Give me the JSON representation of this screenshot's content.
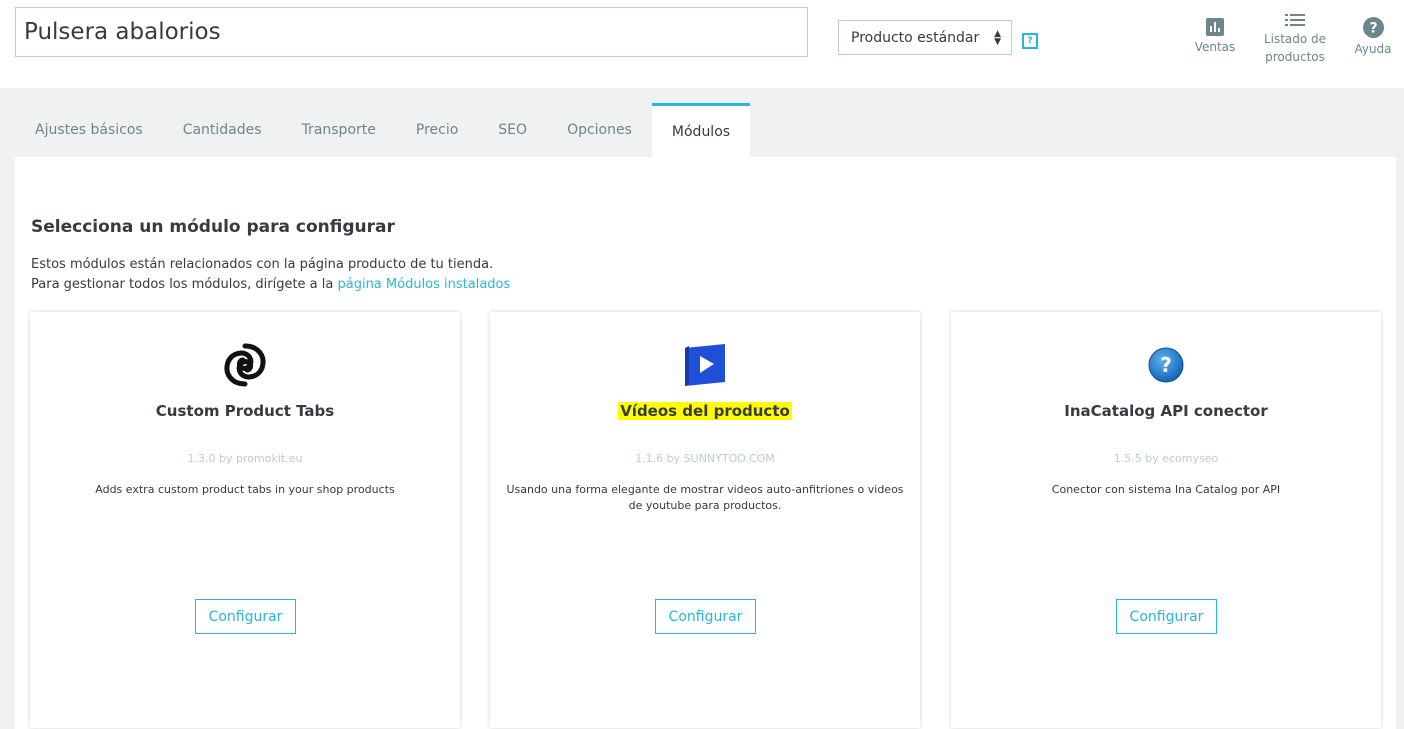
{
  "product": {
    "name_value": "Pulsera abalorios",
    "type_selected": "Producto estándar",
    "help_glyph": "?"
  },
  "header_actions": [
    {
      "label": "Ventas",
      "icon": "chart-icon"
    },
    {
      "label": "Listado de productos",
      "icon": "list-icon"
    },
    {
      "label": "Ayuda",
      "icon": "help-icon"
    }
  ],
  "tabs": [
    {
      "label": "Ajustes básicos"
    },
    {
      "label": "Cantidades"
    },
    {
      "label": "Transporte"
    },
    {
      "label": "Precio"
    },
    {
      "label": "SEO"
    },
    {
      "label": "Opciones"
    },
    {
      "label": "Módulos",
      "active": true
    }
  ],
  "panel": {
    "title": "Selecciona un módulo para configurar",
    "desc_line1": "Estos módulos están relacionados con la página producto de tu tienda.",
    "desc_line2_prefix": "Para gestionar todos los módulos, dirígete a la ",
    "desc_link": "página Módulos instalados"
  },
  "modules": [
    {
      "name": "Custom Product Tabs",
      "version": "1.3.0 by promokit.eu",
      "description": "Adds extra custom product tabs in your shop products",
      "button": "Configurar",
      "icon": "swirl-logo-icon"
    },
    {
      "name": "Vídeos del producto",
      "version": "1.1.6 by SUNNYTOO.COM",
      "description": "Usando una forma elegante de mostrar videos auto-anfitriones o videos de youtube para productos.",
      "button": "Configurar",
      "icon": "video-play-icon",
      "highlight_color": "#fffb00"
    },
    {
      "name": "InaCatalog API conector",
      "version": "1.5.5 by ecomyseo",
      "description": "Conector con sistema Ina Catalog por API",
      "button": "Configurar",
      "icon": "question-globe-icon"
    }
  ],
  "colors": {
    "accent": "#25b9d7",
    "text": "#363a41",
    "muted": "#6c868e",
    "background_gray": "#eff1f2"
  }
}
